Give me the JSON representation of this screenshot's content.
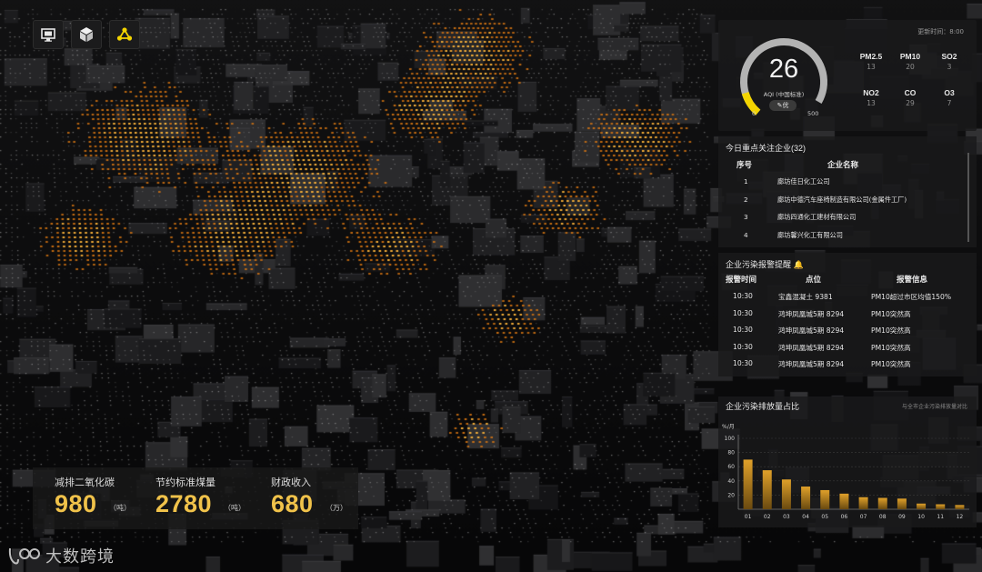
{
  "toolbar": {
    "items": [
      {
        "icon": "monitor-icon"
      },
      {
        "icon": "cube-icon"
      },
      {
        "icon": "network-icon",
        "active": true
      }
    ]
  },
  "aqi": {
    "update_label": "更新时间：8:00",
    "value": "26",
    "standard": "AQI (中国标准)",
    "level": "优",
    "min": "0",
    "max": "500",
    "pollutants": [
      {
        "name": "PM2.5",
        "value": "13"
      },
      {
        "name": "PM10",
        "value": "20"
      },
      {
        "name": "SO2",
        "value": "3"
      },
      {
        "name": "NO2",
        "value": "13"
      },
      {
        "name": "CO",
        "value": "29"
      },
      {
        "name": "O3",
        "value": "7"
      }
    ]
  },
  "enterprises": {
    "title": "今日重点关注企业",
    "count": "(32)",
    "col_no": "序号",
    "col_name": "企业名称",
    "rows": [
      {
        "no": "1",
        "name": "廊坊佳日化工公司"
      },
      {
        "no": "2",
        "name": "廊坊中德汽车座椅制造有限公司(金属件工厂)"
      },
      {
        "no": "3",
        "name": "廊坊四通化工建材有限公司"
      },
      {
        "no": "4",
        "name": "廊坊馨兴化工有限公司"
      }
    ]
  },
  "alarms": {
    "title": "企业污染报警提醒",
    "col_time": "报警时间",
    "col_point": "点位",
    "col_info": "报警信息",
    "rows": [
      {
        "time": "10:30",
        "point": "宝鑫混凝土 9381",
        "info": "PM10超过市区均值150%"
      },
      {
        "time": "10:30",
        "point": "鸿坤凤凰城5期 8294",
        "info": "PM10突然高"
      },
      {
        "time": "10:30",
        "point": "鸿坤凤凰城5期 8294",
        "info": "PM10突然高"
      },
      {
        "time": "10:30",
        "point": "鸿坤凤凰城5期 8294",
        "info": "PM10突然高"
      },
      {
        "time": "10:30",
        "point": "鸿坤凤凰城5期 8294",
        "info": "PM10突然高"
      }
    ]
  },
  "chart_data": {
    "type": "bar",
    "title": "企业污染排放量占比",
    "note": "与全市企业污染排放量对比",
    "ylabel": "%/月",
    "ylim": [
      0,
      100
    ],
    "yticks": [
      "100",
      "80",
      "60",
      "40",
      "20"
    ],
    "categories": [
      "01",
      "02",
      "03",
      "04",
      "05",
      "06",
      "07",
      "08",
      "09",
      "10",
      "11",
      "12"
    ],
    "values": [
      70,
      55,
      42,
      32,
      27,
      22,
      17,
      16,
      15,
      8,
      7,
      6
    ],
    "bar_color": "#e0a12a",
    "grid": true
  },
  "stats": [
    {
      "label": "减排二氧化碳",
      "value": "980",
      "unit": "（吨）"
    },
    {
      "label": "节约标准煤量",
      "value": "2780",
      "unit": "（吨）"
    },
    {
      "label": "财政收入",
      "value": "680",
      "unit": "（万）"
    }
  ],
  "logo": {
    "text": "大数跨境"
  },
  "colors": {
    "accent": "#f0c24a",
    "orange": "#f59a22",
    "gauge": "#f3d400",
    "panel": "#1a1a1b"
  }
}
